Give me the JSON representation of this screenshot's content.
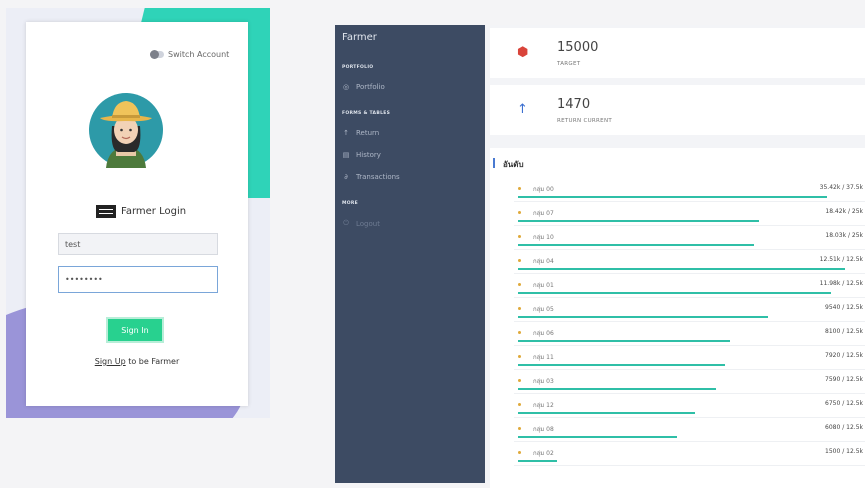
{
  "login": {
    "switch_label": "Switch Account",
    "title": "Farmer Login",
    "username_value": "test",
    "password_value": "••••••••",
    "signin_label": "Sign In",
    "signup_link": "Sign Up",
    "signup_suffix": " to be Farmer"
  },
  "sidebar": {
    "brand": "Farmer",
    "sections": [
      {
        "label": "PORTFOLIO"
      },
      {
        "label": "FORMS & TABLES"
      },
      {
        "label": "MORE"
      }
    ],
    "items": [
      {
        "label": "Portfolio",
        "icon": "target-icon"
      },
      {
        "label": "Return",
        "icon": "arrow-up-icon"
      },
      {
        "label": "History",
        "icon": "document-icon"
      },
      {
        "label": "Transactions",
        "icon": "link-icon"
      },
      {
        "label": "Logout",
        "icon": "power-icon"
      }
    ]
  },
  "stats": {
    "target_value": "15000",
    "target_label": "TARGET",
    "return_value": "1470",
    "return_label": "RETURN CURRENT"
  },
  "ranking": {
    "header": "อันดับ",
    "rows": [
      {
        "name": "กลุ่ม 00",
        "value": "35.42k / 37.5k",
        "progress": 0.945
      },
      {
        "name": "กลุ่ม 07",
        "value": "18.42k / 25k",
        "progress": 0.737
      },
      {
        "name": "กลุ่ม 10",
        "value": "18.03k / 25k",
        "progress": 0.721
      },
      {
        "name": "กลุ่ม 04",
        "value": "12.51k / 12.5k",
        "progress": 1.0
      },
      {
        "name": "กลุ่ม 01",
        "value": "11.98k / 12.5k",
        "progress": 0.958
      },
      {
        "name": "กลุ่ม 05",
        "value": "9540 / 12.5k",
        "progress": 0.763
      },
      {
        "name": "กลุ่ม 06",
        "value": "8100 / 12.5k",
        "progress": 0.648
      },
      {
        "name": "กลุ่ม 11",
        "value": "7920 / 12.5k",
        "progress": 0.634
      },
      {
        "name": "กลุ่ม 03",
        "value": "7590 / 12.5k",
        "progress": 0.607
      },
      {
        "name": "กลุ่ม 12",
        "value": "6750 / 12.5k",
        "progress": 0.54
      },
      {
        "name": "กลุ่ม 08",
        "value": "6080 / 12.5k",
        "progress": 0.486
      },
      {
        "name": "กลุ่ม 02",
        "value": "1500 / 12.5k",
        "progress": 0.12
      }
    ]
  },
  "colors": {
    "sidebar": "#3d4b63",
    "accent_teal": "#2fbfa7",
    "signin_green": "#28d18f",
    "target_red": "#d9443a",
    "return_blue": "#3b6fd0"
  }
}
